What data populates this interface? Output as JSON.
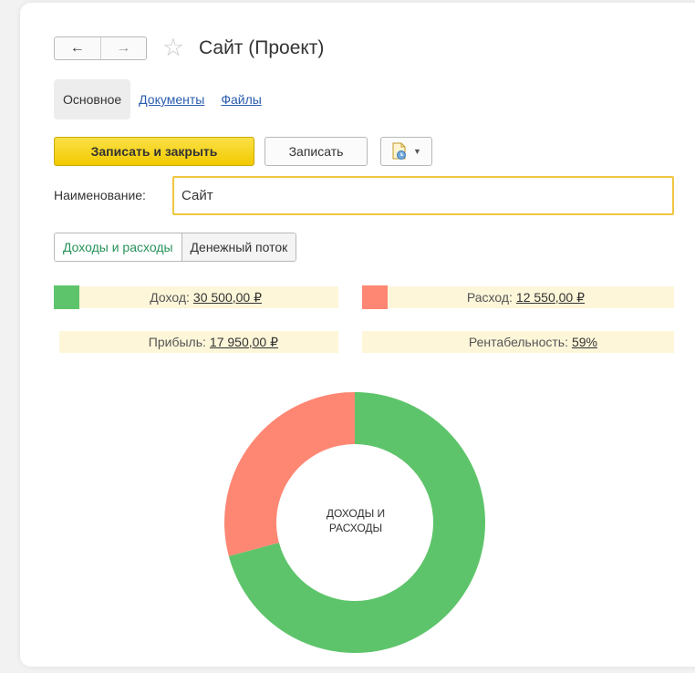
{
  "header": {
    "back_icon": "arrow-left-icon",
    "forward_icon": "arrow-right-icon",
    "back_glyph": "←",
    "forward_glyph": "→",
    "favorite_icon": "star-icon",
    "favorite_glyph": "☆",
    "title": "Сайт (Проект)"
  },
  "tabs": [
    {
      "label": "Основное",
      "active": true
    },
    {
      "label": "Документы",
      "active": false
    },
    {
      "label": "Файлы",
      "active": false
    }
  ],
  "toolbar": {
    "save_close_label": "Записать и закрыть",
    "save_label": "Записать",
    "menu_icon": "document-clock-icon",
    "menu_caret": "▼"
  },
  "form": {
    "name_label": "Наименование:",
    "name_value": "Сайт"
  },
  "view_switch": [
    {
      "label": "Доходы и расходы",
      "active": true
    },
    {
      "label": "Денежный поток",
      "active": false
    }
  ],
  "stats": {
    "income_label": "Доход:",
    "income_value": "30 500,00 ₽",
    "expense_label": "Расход:",
    "expense_value": "12 550,00 ₽",
    "profit_label": "Прибыль:",
    "profit_value": "17 950,00 ₽",
    "profitability_label": "Рентабельность:",
    "profitability_value": "59%"
  },
  "colors": {
    "income": "#5ec46b",
    "expense": "#fd8773",
    "primary_button": "#f5d20e",
    "link": "#2a5cad"
  },
  "chart_data": {
    "type": "pie",
    "title": "",
    "center_label_line1": "ДОХОДЫ И",
    "center_label_line2": "РАСХОДЫ",
    "slices": [
      {
        "value": 30500,
        "color": "#5ec46b"
      },
      {
        "value": 12550,
        "color": "#fd8773"
      }
    ]
  }
}
